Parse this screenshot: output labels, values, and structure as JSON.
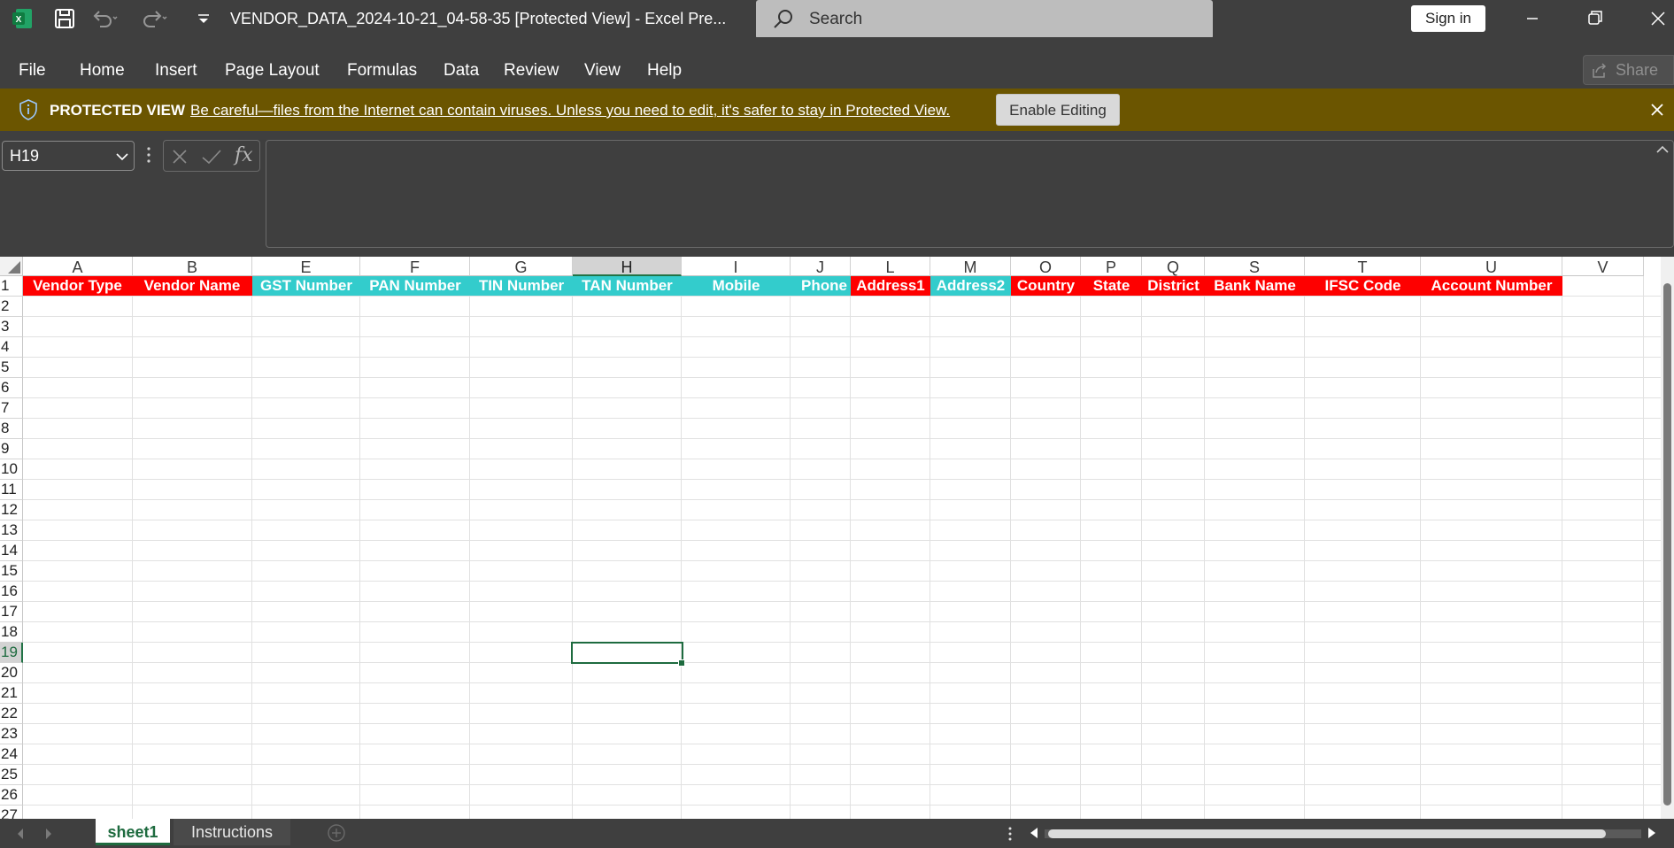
{
  "titlebar": {
    "document_title": "VENDOR_DATA_2024-10-21_04-58-35  [Protected View]  -  Excel Pre...",
    "search_placeholder": "Search",
    "signin_label": "Sign in"
  },
  "ribbon": {
    "tabs": [
      "File",
      "Home",
      "Insert",
      "Page Layout",
      "Formulas",
      "Data",
      "Review",
      "View",
      "Help"
    ],
    "share_label": "Share"
  },
  "protected_view": {
    "title": "PROTECTED VIEW",
    "message": "Be careful—files from the Internet can contain viruses. Unless you need to edit, it's safer to stay in Protected View.",
    "enable_label": "Enable Editing"
  },
  "formula_bar": {
    "name_box": "H19",
    "fx_label": "fx",
    "formula_value": ""
  },
  "grid": {
    "column_letters": [
      "A",
      "B",
      "E",
      "F",
      "G",
      "H",
      "I",
      "J",
      "L",
      "M",
      "O",
      "P",
      "Q",
      "S",
      "T",
      "U",
      "V"
    ],
    "selected_column": "H",
    "selected_row": 19,
    "row_numbers": [
      "1",
      "2",
      "3",
      "4",
      "5",
      "6",
      "7",
      "8",
      "9",
      "10",
      "11",
      "12",
      "13",
      "14",
      "15",
      "16",
      "17",
      "18",
      "19",
      "20",
      "21",
      "22",
      "23",
      "24",
      "25",
      "26",
      "27"
    ],
    "header_row": [
      {
        "text": "Vendor Type",
        "color": "#fe0000"
      },
      {
        "text": "Vendor Name",
        "color": "#fe0000"
      },
      {
        "text": "GST Number",
        "color": "#33cccc"
      },
      {
        "text": "PAN Number",
        "color": "#33cccc"
      },
      {
        "text": "TIN Number",
        "color": "#33cccc"
      },
      {
        "text": "TAN Number",
        "color": "#33cccc"
      },
      {
        "text": "Mobile",
        "color": "#33cccc"
      },
      {
        "text": "Phone",
        "color": "#33cccc"
      },
      {
        "text": "Address1",
        "color": "#fe0000"
      },
      {
        "text": "Address2",
        "color": "#33cccc"
      },
      {
        "text": "Country",
        "color": "#fe0000"
      },
      {
        "text": "State",
        "color": "#fe0000"
      },
      {
        "text": "District",
        "color": "#fe0000"
      },
      {
        "text": "Bank Name",
        "color": "#fe0000"
      },
      {
        "text": "IFSC Code",
        "color": "#fe0000"
      },
      {
        "text": "Account Number",
        "color": "#fe0000"
      }
    ]
  },
  "sheets": {
    "tabs": [
      "sheet1",
      "Instructions"
    ],
    "active": "sheet1"
  },
  "colors": {
    "chrome": "#3f3f3f",
    "protected_bar": "#6b5500",
    "accent_green": "#1e6b3f",
    "required_red": "#fe0000",
    "optional_teal": "#33cccc"
  }
}
